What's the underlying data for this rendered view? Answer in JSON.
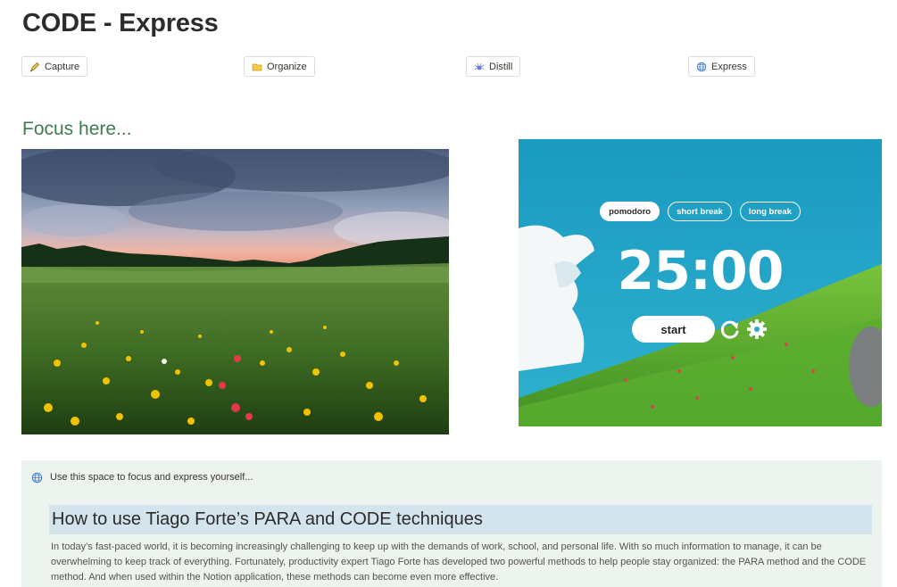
{
  "page": {
    "title": "CODE - Express"
  },
  "nav": [
    {
      "label": "Capture",
      "icon": "pencil-icon"
    },
    {
      "label": "Organize",
      "icon": "folder-icon"
    },
    {
      "label": "Distill",
      "icon": "spider-icon"
    },
    {
      "label": "Express",
      "icon": "globe-icon"
    }
  ],
  "focus": {
    "heading": "Focus here..."
  },
  "pomodoro": {
    "tabs": [
      "pomodoro",
      "short break",
      "long break"
    ],
    "active_tab": "pomodoro",
    "time": "25:00",
    "start_label": "start"
  },
  "callout": {
    "icon": "globe-icon",
    "text": "Use this space to focus and express yourself...",
    "heading": "How to use Tiago Forte’s PARA and CODE techniques",
    "paragraph": "In today’s fast-paced world, it is becoming increasingly challenging to keep up with the demands of work, school, and personal life. With so much information to manage, it can be overwhelming to keep track of everything. Fortunately, productivity expert Tiago Forte has developed two powerful methods to help people stay organized: the PARA method and the CODE method. And when used within the Notion application, these methods can become even more effective."
  },
  "colors": {
    "accent_green": "#3f7a52",
    "callout_bg": "#edf3ee",
    "heading_highlight": "#d3e4ec",
    "pomodoro_sky": "#1f9fc0"
  }
}
